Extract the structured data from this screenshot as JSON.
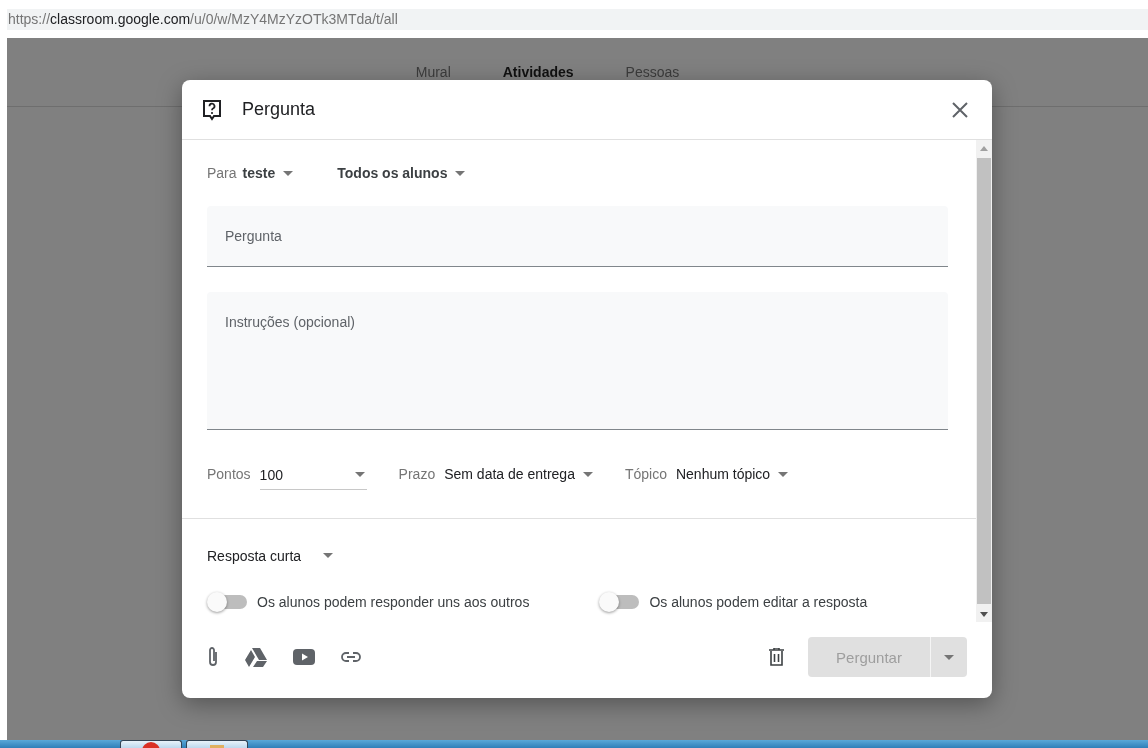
{
  "browser": {
    "url": {
      "scheme": "https://",
      "host": "classroom.google.com",
      "path": "/u/0/w/MzY4MzYzOTk3MTda/t/all"
    }
  },
  "nav_tabs": [
    {
      "label": "Mural",
      "selected": false
    },
    {
      "label": "Atividades",
      "selected": true
    },
    {
      "label": "Pessoas",
      "selected": false
    }
  ],
  "dialog": {
    "title": "Pergunta",
    "audience": {
      "for_label": "Para",
      "class_value": "teste",
      "students_value": "Todos os alunos"
    },
    "question_field": {
      "placeholder": "Pergunta"
    },
    "instructions_field": {
      "placeholder": "Instruções (opcional)"
    },
    "settings": [
      {
        "kind": "input",
        "label": "Pontos",
        "value": "100"
      },
      {
        "kind": "dropdown",
        "label": "Prazo",
        "value": "Sem data de entrega"
      },
      {
        "kind": "dropdown",
        "label": "Tópico",
        "value": "Nenhum tópico"
      }
    ],
    "answer_type": "Resposta curta",
    "toggles": [
      {
        "label": "Os alunos podem responder uns aos outros",
        "on": false
      },
      {
        "label": "Os alunos podem editar a resposta",
        "on": false
      }
    ],
    "submit": {
      "label": "Perguntar",
      "disabled": true
    }
  },
  "taskbar": {
    "buttons": [
      {
        "kind": "browser"
      },
      {
        "kind": "folder"
      }
    ]
  }
}
